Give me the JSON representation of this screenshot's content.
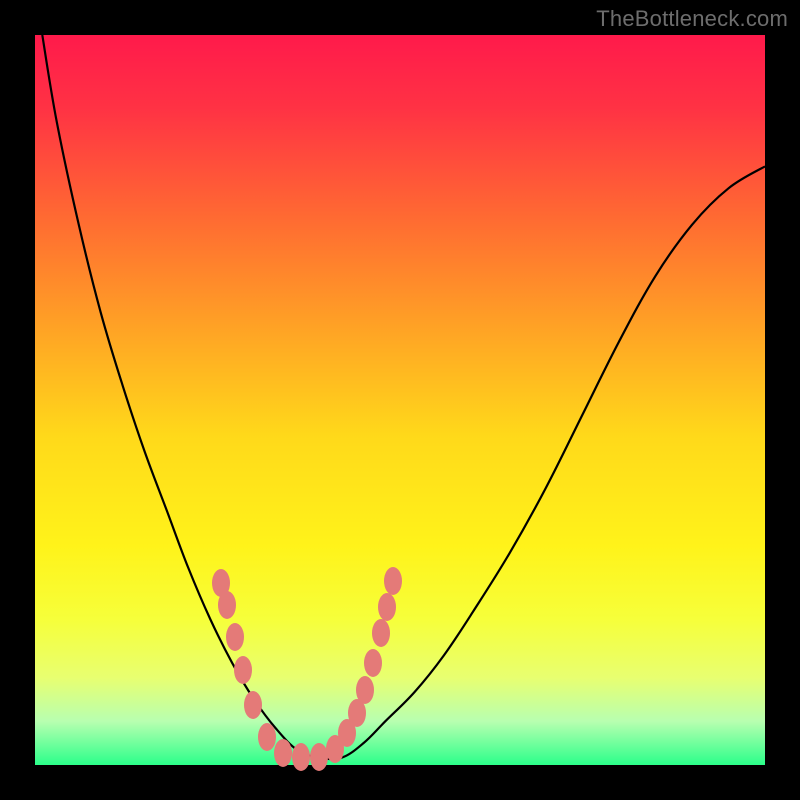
{
  "watermark": "TheBottleneck.com",
  "gradient": {
    "stops": [
      {
        "pos": 0.0,
        "color": "#ff1a4b"
      },
      {
        "pos": 0.1,
        "color": "#ff3244"
      },
      {
        "pos": 0.25,
        "color": "#ff6a32"
      },
      {
        "pos": 0.4,
        "color": "#ffa225"
      },
      {
        "pos": 0.55,
        "color": "#ffd91a"
      },
      {
        "pos": 0.7,
        "color": "#fff31a"
      },
      {
        "pos": 0.8,
        "color": "#f6ff3a"
      },
      {
        "pos": 0.88,
        "color": "#e8ff70"
      },
      {
        "pos": 0.94,
        "color": "#b8ffb0"
      },
      {
        "pos": 1.0,
        "color": "#2bff8a"
      }
    ]
  },
  "curve_stroke": "#000000",
  "curve_stroke_width": 2.2,
  "markers": {
    "color": "#e47a78",
    "rx": 9,
    "ry": 14,
    "points": [
      {
        "x": 186,
        "y": 548
      },
      {
        "x": 192,
        "y": 570
      },
      {
        "x": 200,
        "y": 602
      },
      {
        "x": 208,
        "y": 635
      },
      {
        "x": 218,
        "y": 670
      },
      {
        "x": 232,
        "y": 702
      },
      {
        "x": 248,
        "y": 718
      },
      {
        "x": 266,
        "y": 722
      },
      {
        "x": 284,
        "y": 722
      },
      {
        "x": 300,
        "y": 714
      },
      {
        "x": 312,
        "y": 698
      },
      {
        "x": 322,
        "y": 678
      },
      {
        "x": 330,
        "y": 655
      },
      {
        "x": 338,
        "y": 628
      },
      {
        "x": 346,
        "y": 598
      },
      {
        "x": 352,
        "y": 572
      },
      {
        "x": 358,
        "y": 546
      }
    ]
  },
  "chart_data": {
    "type": "line",
    "title": "",
    "xlabel": "",
    "ylabel": "",
    "x_range": [
      0,
      100
    ],
    "y_range": [
      0,
      100
    ],
    "x": [
      1,
      3,
      6,
      9,
      12,
      15,
      18,
      21,
      24,
      27,
      30,
      33,
      36,
      39,
      42,
      45,
      48,
      52,
      56,
      60,
      65,
      70,
      75,
      80,
      85,
      90,
      95,
      100
    ],
    "series": [
      {
        "name": "bottleneck-curve",
        "values": [
          100,
          88,
          74,
          62,
          52,
          43,
          35,
          27,
          20,
          14,
          9,
          5,
          2,
          1,
          1,
          3,
          6,
          10,
          15,
          21,
          29,
          38,
          48,
          58,
          67,
          74,
          79,
          82
        ]
      }
    ],
    "highlight_x_range": [
      24,
      50
    ],
    "annotations": []
  }
}
